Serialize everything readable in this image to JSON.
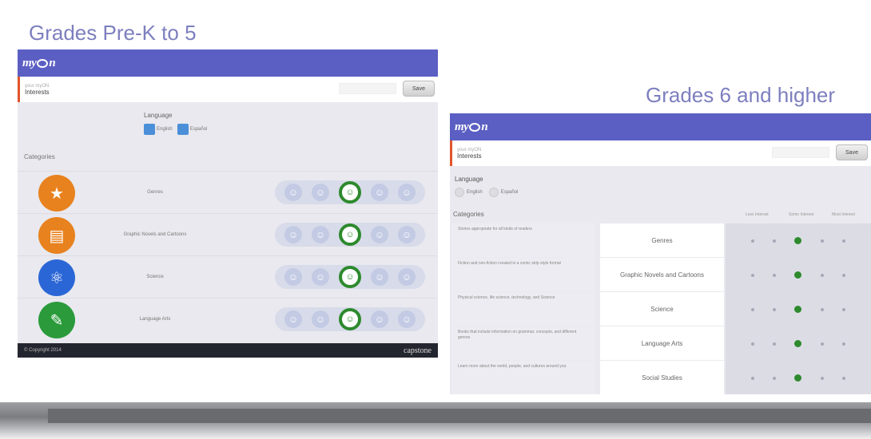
{
  "headings": {
    "left": "Grades Pre-K to 5",
    "right": "Grades 6 and higher"
  },
  "app": {
    "logo": "myOn",
    "brand_color": "#5b5fc3",
    "accent": "#e2542c",
    "select_color": "#2d8a2d"
  },
  "left_panel": {
    "profile_sub": "your myON",
    "profile_title": "Interests",
    "save_label": "Save",
    "language_label": "Language",
    "languages": [
      "English",
      "Español"
    ],
    "categories_label": "Categories",
    "categories": [
      {
        "name": "Genres",
        "icon": "genres-icon",
        "color": "#e8821f",
        "glyph": "★"
      },
      {
        "name": "Graphic Novels and Cartoons",
        "icon": "graphic-novel-icon",
        "color": "#e8821f",
        "glyph": "▤"
      },
      {
        "name": "Science",
        "icon": "atom-icon",
        "color": "#2b66d6",
        "glyph": "⚛"
      },
      {
        "name": "Language Arts",
        "icon": "book-icon",
        "color": "#2a9a3a",
        "glyph": "✎"
      }
    ],
    "faces": [
      "☺",
      "☺",
      "☺",
      "☺",
      "☺"
    ],
    "selected_index": 2,
    "footer_text": "© Copyright 2014",
    "footer_brand": "capstone"
  },
  "right_panel": {
    "profile_sub": "your myON",
    "profile_title": "Interests",
    "save_label": "Save",
    "language_label": "Language",
    "languages": [
      "English",
      "Español"
    ],
    "categories_label": "Categories",
    "column_labels": [
      "Less Interest",
      "Some Interest",
      "Most Interest"
    ],
    "categories": [
      {
        "desc": "Stories appropriate for all kinds of readers",
        "name": "Genres"
      },
      {
        "desc": "Fiction and non-fiction created in a comic strip style format",
        "name": "Graphic Novels and Cartoons"
      },
      {
        "desc": "Physical science, life science, technology, and Science",
        "name": "Science"
      },
      {
        "desc": "Books that include information on grammar, concepts, and different genres",
        "name": "Language Arts"
      },
      {
        "desc": "Learn more about the world, people, and cultures around you",
        "name": "Social Studies"
      }
    ],
    "selected_index": 2
  }
}
